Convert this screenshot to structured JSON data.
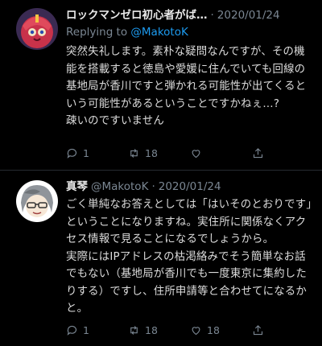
{
  "tweets": [
    {
      "name": "ロックマンゼロ初心者がば…",
      "date": "2020/01/24",
      "reply_prefix": "Replying to",
      "reply_handle": "@MakotoK",
      "text": "突然失礼します。素朴な疑問なんですが、その機能を搭載すると徳島や愛媛に住んでいても回線の基地局が香川ですと弾かれる可能性が出てくるという可能性があるということですかねぇ…?\n疎いのですいません",
      "counts": {
        "reply": "1",
        "retweet": "18",
        "like": ""
      }
    },
    {
      "name": "真琴",
      "handle": "@MakotoK",
      "date": "2020/01/24",
      "text": "ごく単純なお答えとしては「はいそのとおりです」ということになりますね。実住所に関係なくアクセス情報で見ることになるでしょうから。\n実際にはIPアドレスの枯渇絡みでそう簡単なお話でもない（基地局が香川でも一度東京に集約したりする）ですし、住所申請等と合わせてになるかと。",
      "counts": {
        "reply": "1",
        "retweet": "18",
        "like": "18"
      }
    }
  ],
  "separator": "·",
  "colors": {
    "background": "#000000",
    "link": "#1d9bf0",
    "muted": "#7b8793"
  }
}
